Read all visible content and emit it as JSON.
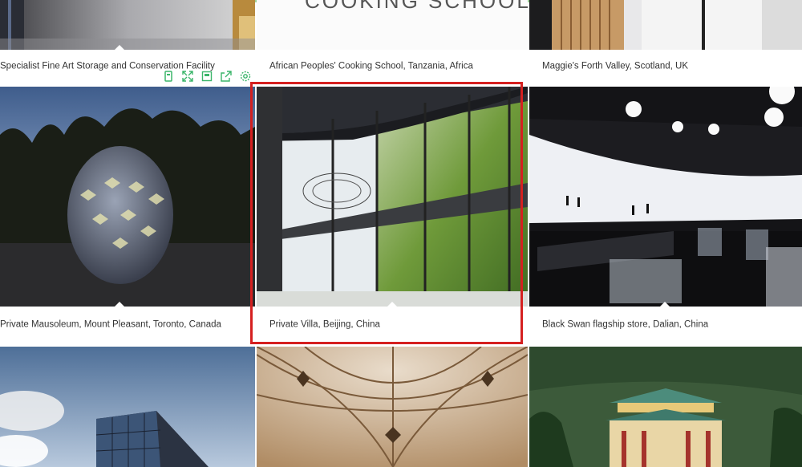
{
  "header_fragment": "COOKING SCHOOL",
  "captions": {
    "storage": "Specialist Fine Art Storage and Conservation Facility",
    "cooking": "African Peoples' Cooking School, Tanzania, Africa",
    "maggies": "Maggie's Forth Valley, Scotland, UK",
    "mausoleum": "Private Mausoleum, Mount Pleasant, Toronto, Canada",
    "villa": "Private Villa, Beijing, China",
    "swan": "Black Swan flagship store, Dalian, China"
  },
  "toolbar_icons": [
    "bookmark-icon",
    "expand-icon",
    "save-icon",
    "share-icon",
    "settings-icon"
  ],
  "colors": {
    "accent_green": "#3bb56a",
    "highlight_red": "#d52020",
    "top_line": "#9fd39a"
  }
}
